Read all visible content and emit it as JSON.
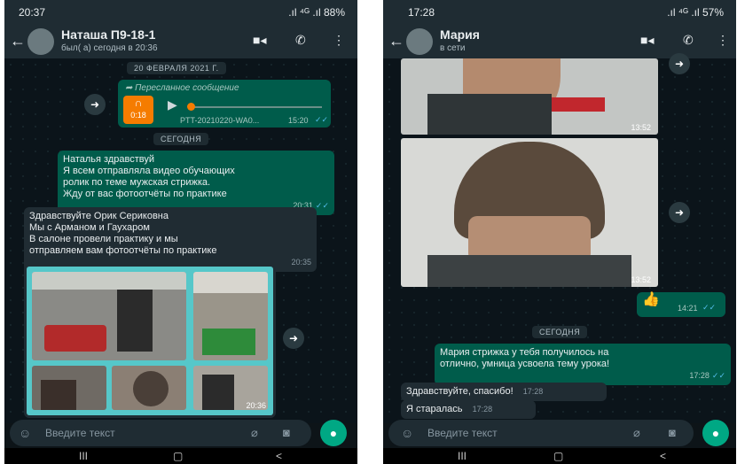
{
  "left": {
    "status_time": "20:37",
    "status_right": ".ıl ⁴ᴳ .ıl 88%",
    "contact_name": "Наташа П9-18-1",
    "contact_status": "был( а) сегодня в 20:36",
    "date_1": "20 ФЕВРАЛЯ 2021 Г.",
    "forwarded_label": "Пересланное сообщение",
    "audio_duration": "0:18",
    "audio_file": "PTT-20210220-WA0...",
    "audio_time": "15:20",
    "date_2": "СЕГОДНЯ",
    "msg1_lines": [
      "Наталья здравствуй",
      "Я всем отправляла видео обучающих",
      "ролик по теме мужская стрижка.",
      "Жду от вас фотоотчёты по практике"
    ],
    "msg1_time": "20:31",
    "msg2_lines": [
      "Здравствуйте Орик Сериковна",
      "Мы с Арманом и Гаухаром",
      "В салоне провели практику и мы",
      "отправляем вам фотоотчёты по практике"
    ],
    "msg2_time": "20:35",
    "collage_time": "20:36",
    "input_placeholder": "Введите текст"
  },
  "right": {
    "status_time": "17:28",
    "status_right": ".ıl ⁴ᴳ .ıl 57%",
    "contact_name": "Мария",
    "contact_status": "в сети",
    "photo1_time": "13:52",
    "photo2_time": "13:52",
    "thumb_emoji": "👍",
    "thumb_time": "14:21",
    "date_today": "СЕГОДНЯ",
    "msg_out_lines": [
      "Мария стрижка у тебя получилось на",
      "отлично, умница усвоела тему урока!"
    ],
    "msg_out_time": "17:28",
    "msg_in1": "Здравствуйте, спасибо!",
    "msg_in1_time": "17:28",
    "msg_in2": "Я старалась",
    "msg_in2_time": "17:28",
    "input_placeholder": "Введите текст"
  },
  "icons": [
    "back-arrow-icon",
    "video-call-icon",
    "phone-icon",
    "menu-dots-icon",
    "forward-icon",
    "headphones-icon",
    "play-icon",
    "double-check-icon",
    "emoji-icon",
    "attach-icon",
    "camera-icon",
    "mic-icon"
  ],
  "colors": {
    "header": "#1f2c33",
    "outgoing": "#005c4b",
    "incoming": "#202c33",
    "accent": "#00a884",
    "audio_badge": "#f57c00",
    "check": "#53bdeb"
  }
}
